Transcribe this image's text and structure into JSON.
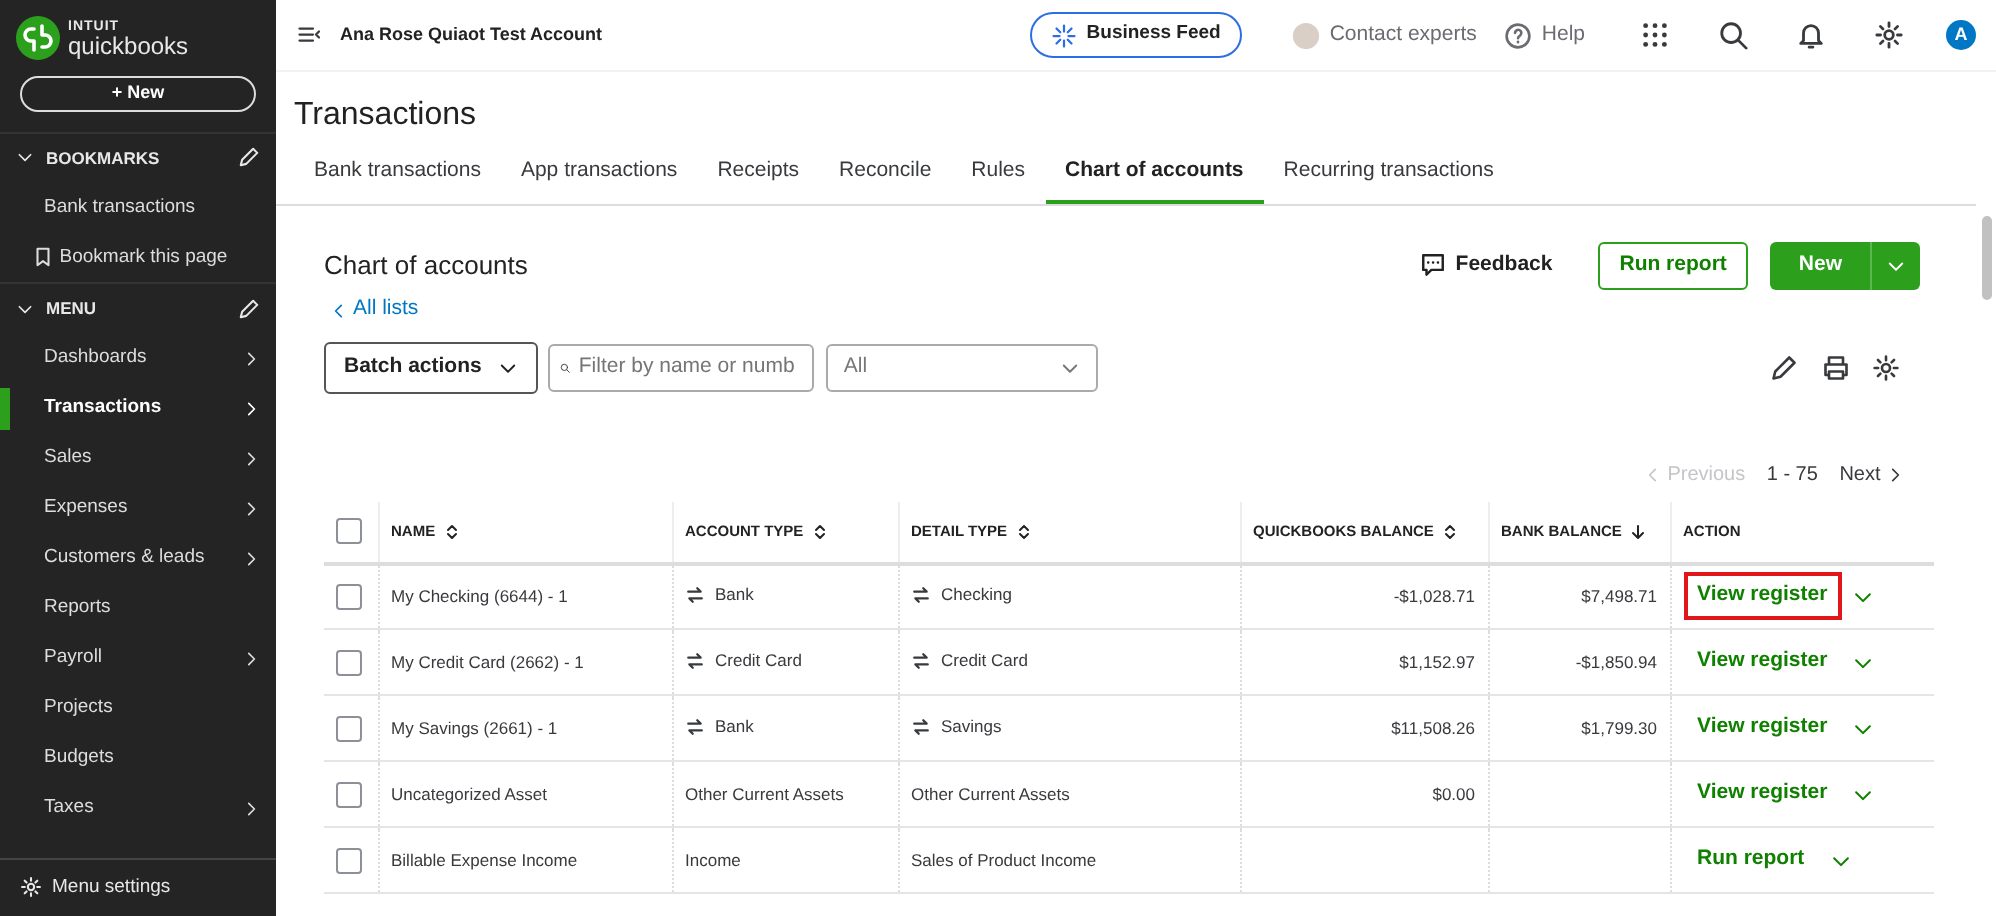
{
  "sidebar": {
    "logo": {
      "brand_top": "INTUIT",
      "brand": "quickbooks"
    },
    "new_button": "+ New",
    "sections": [
      {
        "title": "BOOKMARKS",
        "expanded": true,
        "items": [
          {
            "label": "Bank transactions",
            "kind": "link"
          },
          {
            "label": "Bookmark this page",
            "kind": "bookmark"
          }
        ]
      },
      {
        "title": "MENU",
        "expanded": true,
        "items": [
          {
            "label": "Dashboards",
            "kind": "menu",
            "selected": false,
            "has_submenu": true
          },
          {
            "label": "Transactions",
            "kind": "menu",
            "selected": true,
            "has_submenu": true
          },
          {
            "label": "Sales",
            "kind": "menu",
            "selected": false,
            "has_submenu": true
          },
          {
            "label": "Expenses",
            "kind": "menu",
            "selected": false,
            "has_submenu": true
          },
          {
            "label": "Customers & leads",
            "kind": "menu",
            "selected": false,
            "has_submenu": true
          },
          {
            "label": "Reports",
            "kind": "menu",
            "selected": false,
            "has_submenu": false
          },
          {
            "label": "Payroll",
            "kind": "menu",
            "selected": false,
            "has_submenu": true
          },
          {
            "label": "Projects",
            "kind": "menu",
            "selected": false,
            "has_submenu": false
          },
          {
            "label": "Budgets",
            "kind": "menu",
            "selected": false,
            "has_submenu": false
          },
          {
            "label": "Taxes",
            "kind": "menu",
            "selected": false,
            "has_submenu": true
          }
        ]
      }
    ],
    "footer": "Menu settings"
  },
  "topbar": {
    "account": "Ana Rose Quiaot Test Account",
    "business_feed": "Business Feed",
    "contact": "Contact experts",
    "help": "Help",
    "avatar": "A"
  },
  "page_title": "Transactions",
  "tabs": [
    {
      "label": "Bank transactions",
      "selected": false
    },
    {
      "label": "App transactions",
      "selected": false
    },
    {
      "label": "Receipts",
      "selected": false
    },
    {
      "label": "Reconcile",
      "selected": false
    },
    {
      "label": "Rules",
      "selected": false
    },
    {
      "label": "Chart of accounts",
      "selected": true
    },
    {
      "label": "Recurring transactions",
      "selected": false
    }
  ],
  "panel": {
    "title": "Chart of accounts",
    "back_link": "All lists",
    "feedback": "Feedback",
    "run_report": "Run report",
    "new_button": "New",
    "batch_actions": "Batch actions",
    "filter": {
      "placeholder": "Filter by name or numb"
    },
    "type_select": "All",
    "pagination": {
      "previous": "Previous",
      "previous_disabled": true,
      "range": "1 - 75",
      "next": "Next",
      "next_disabled": false
    }
  },
  "table": {
    "select_all_checked": false,
    "columns": [
      {
        "label": "NAME",
        "sortable": true,
        "sorted_descending": false
      },
      {
        "label": "ACCOUNT TYPE",
        "sortable": true,
        "sorted_descending": false
      },
      {
        "label": "DETAIL TYPE",
        "sortable": true,
        "sorted_descending": false
      },
      {
        "label": "QUICKBOOKS BALANCE",
        "sortable": true,
        "sorted_descending": false
      },
      {
        "label": "BANK BALANCE",
        "sortable": true,
        "sorted_descending": true
      },
      {
        "label": "ACTION",
        "sortable": false
      }
    ],
    "rows": [
      {
        "checked": false,
        "name": "My Checking (6644) - 1",
        "linked": true,
        "account_type": "Bank",
        "detail_type": "Checking",
        "qb_balance": "-$1,028.71",
        "bank_balance": "$7,498.71",
        "action": "View register",
        "highlighted": true
      },
      {
        "checked": false,
        "name": "My Credit Card (2662) - 1",
        "linked": true,
        "account_type": "Credit Card",
        "detail_type": "Credit Card",
        "qb_balance": "$1,152.97",
        "bank_balance": "-$1,850.94",
        "action": "View register",
        "highlighted": false
      },
      {
        "checked": false,
        "name": "My Savings (2661) - 1",
        "linked": true,
        "account_type": "Bank",
        "detail_type": "Savings",
        "qb_balance": "$11,508.26",
        "bank_balance": "$1,799.30",
        "action": "View register",
        "highlighted": false
      },
      {
        "checked": false,
        "name": "Uncategorized Asset",
        "linked": false,
        "account_type": "Other Current Assets",
        "detail_type": "Other Current Assets",
        "qb_balance": "$0.00",
        "action": "View register",
        "highlighted": false
      },
      {
        "checked": false,
        "name": "Billable Expense Income",
        "linked": false,
        "account_type": "Income",
        "detail_type": "Sales of Product Income",
        "action": "Run report",
        "highlighted": false
      }
    ]
  }
}
